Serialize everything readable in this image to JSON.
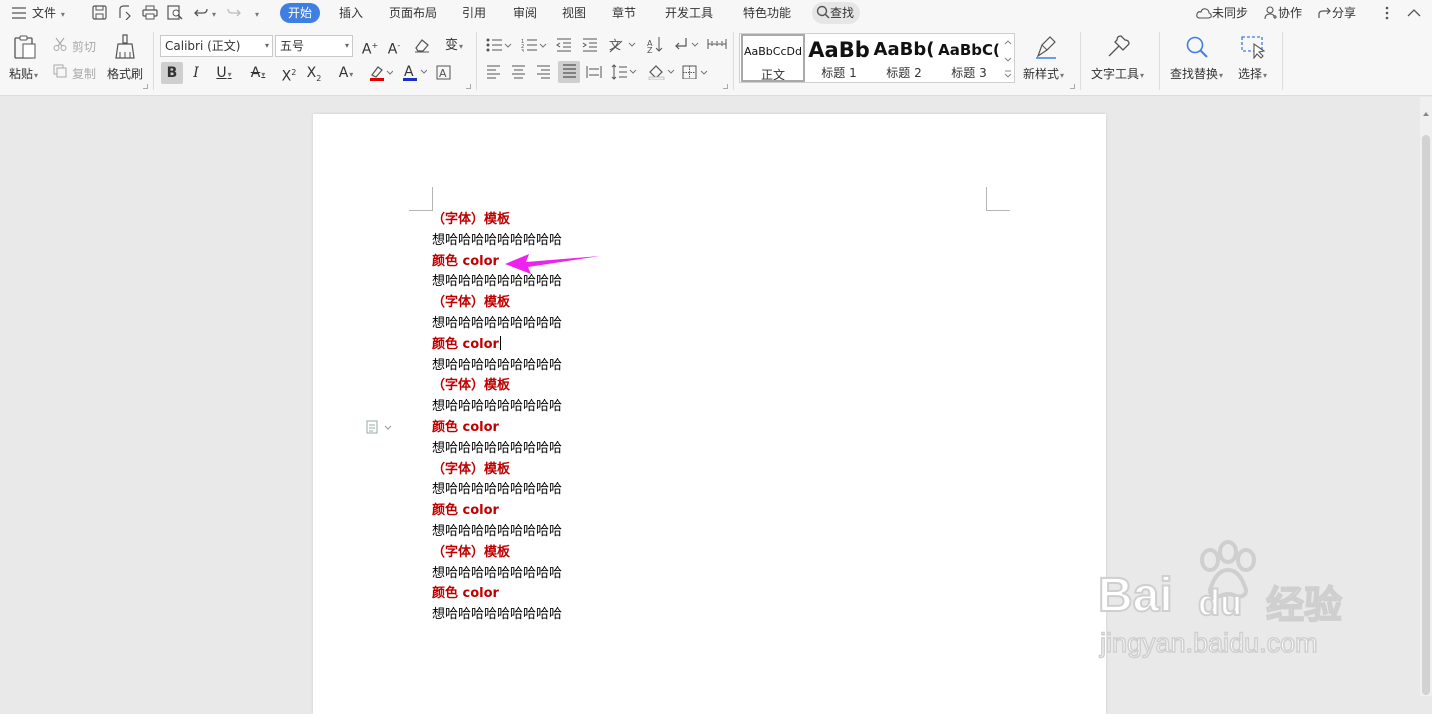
{
  "menubar": {
    "file_label": "文件",
    "tabs": [
      "开始",
      "插入",
      "页面布局",
      "引用",
      "审阅",
      "视图",
      "章节",
      "开发工具",
      "特色功能"
    ],
    "active_tab": "开始",
    "search_label": "查找",
    "sync_label": "未同步",
    "collab_label": "协作",
    "share_label": "分享"
  },
  "ribbon": {
    "clipboard": {
      "paste": "粘贴",
      "cut": "剪切",
      "copy": "复制",
      "format_painter": "格式刷"
    },
    "font": {
      "family": "Calibri (正文)",
      "size": "五号"
    },
    "styles": [
      {
        "preview": "AaBbCcDd",
        "name": "正文"
      },
      {
        "preview": "AaBb",
        "name": "标题 1"
      },
      {
        "preview": "AaBb(",
        "name": "标题 2"
      },
      {
        "preview": "AaBbC(",
        "name": "标题 3"
      }
    ],
    "new_style": "新样式",
    "text_tools": "文字工具",
    "find_replace": "查找替换",
    "select": "选择"
  },
  "document": {
    "lines": [
      {
        "text": "（字体）模板",
        "style": "head"
      },
      {
        "text": "想哈哈哈哈哈哈哈哈哈",
        "style": "body"
      },
      {
        "text": "颜色 color",
        "style": "head"
      },
      {
        "text": "想哈哈哈哈哈哈哈哈哈",
        "style": "body"
      },
      {
        "text": "（字体）模板",
        "style": "head"
      },
      {
        "text": "想哈哈哈哈哈哈哈哈哈",
        "style": "body"
      },
      {
        "text": "颜色 color",
        "style": "head"
      },
      {
        "text": "想哈哈哈哈哈哈哈哈哈",
        "style": "body"
      },
      {
        "text": "（字体）模板",
        "style": "head"
      },
      {
        "text": "想哈哈哈哈哈哈哈哈哈",
        "style": "body"
      },
      {
        "text": "颜色 color",
        "style": "head"
      },
      {
        "text": "想哈哈哈哈哈哈哈哈哈",
        "style": "body"
      },
      {
        "text": "（字体）模板",
        "style": "head"
      },
      {
        "text": "想哈哈哈哈哈哈哈哈哈",
        "style": "body"
      },
      {
        "text": "颜色 color",
        "style": "head"
      },
      {
        "text": "想哈哈哈哈哈哈哈哈哈",
        "style": "body"
      },
      {
        "text": "（字体）模板",
        "style": "head"
      },
      {
        "text": "想哈哈哈哈哈哈哈哈哈",
        "style": "body"
      },
      {
        "text": "颜色 color",
        "style": "head"
      },
      {
        "text": "想哈哈哈哈哈哈哈哈哈",
        "style": "body"
      }
    ],
    "caret_line_index": 6
  },
  "watermark": {
    "brand": "Bai",
    "brand2": "du",
    "suffix": "经验",
    "url": "jingyan.baidu.com"
  },
  "colors": {
    "accent": "#3f7fe3",
    "heading_red": "#c00000",
    "arrow_magenta": "#ee22ee"
  },
  "icons": [
    "hamburger-menu-icon",
    "save-icon",
    "print-icon",
    "print-preview-icon",
    "undo-icon",
    "redo-icon",
    "search-icon",
    "cloud-sync-icon",
    "collaborate-icon",
    "share-icon",
    "more-icon",
    "collapse-ribbon-icon"
  ]
}
